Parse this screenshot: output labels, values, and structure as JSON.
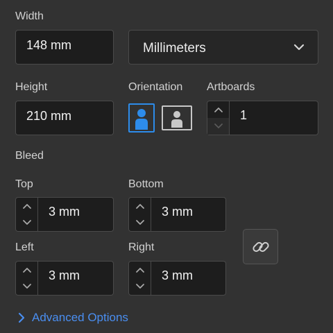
{
  "width": {
    "label": "Width",
    "value": "148 mm"
  },
  "units": {
    "selected": "Millimeters",
    "icon": "chevron-down-icon"
  },
  "height": {
    "label": "Height",
    "value": "210 mm"
  },
  "orientation": {
    "label": "Orientation",
    "portrait_icon": "portrait-orientation-icon",
    "landscape_icon": "landscape-orientation-icon",
    "selected": "portrait"
  },
  "artboards": {
    "label": "Artboards",
    "value": "1"
  },
  "bleed": {
    "label": "Bleed",
    "top": {
      "label": "Top",
      "value": "3 mm"
    },
    "bottom": {
      "label": "Bottom",
      "value": "3 mm"
    },
    "left": {
      "label": "Left",
      "value": "3 mm"
    },
    "right": {
      "label": "Right",
      "value": "3 mm"
    },
    "link_icon": "link-icon"
  },
  "advanced": {
    "label": "Advanced Options",
    "icon": "chevron-right-icon"
  },
  "colors": {
    "accent": "#4a8ef0",
    "panel_bg": "#323232",
    "field_bg": "#1d1d1d",
    "selected_orientation": "#2d8ceb"
  }
}
